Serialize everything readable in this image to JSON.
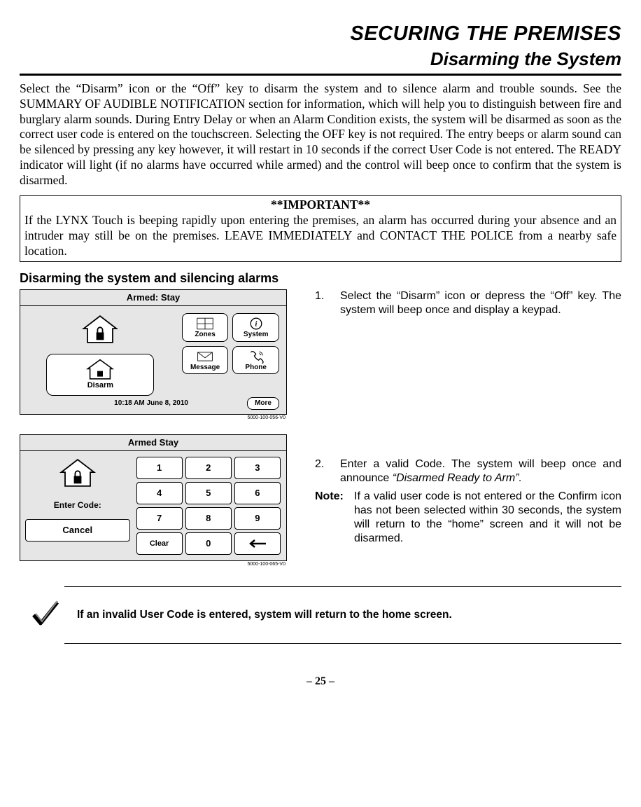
{
  "header": {
    "title": "SECURING THE PREMISES",
    "subtitle": "Disarming the System"
  },
  "intro": "Select the “Disarm” icon or the “Off” key to disarm the system and to silence alarm and trouble sounds. See the SUMMARY OF AUDIBLE NOTIFICATION section for information, which will help you to distinguish between fire and burglary alarm sounds. During Entry Delay or when an Alarm Condition exists, the system will be disarmed as soon as the correct user code is entered on the touchscreen. Selecting the OFF key is not required. The entry beeps or alarm sound can be silenced by pressing any key however, it will restart in 10 seconds if the correct User Code is not entered. The READY indicator will light (if no alarms have occurred while armed) and the control will beep once to confirm that the system is disarmed.",
  "important": {
    "title": "**IMPORTANT**",
    "body": "If the LYNX Touch is beeping rapidly upon entering the premises, an alarm has occurred during your absence and an intruder may still be on the premises. LEAVE IMMEDIATELY and CONTACT THE POLICE from a nearby safe location."
  },
  "section": "Disarming the system and silencing alarms",
  "panel1": {
    "title": "Armed: Stay",
    "disarm": "Disarm",
    "zones": "Zones",
    "system": "System",
    "message": "Message",
    "phone": "Phone",
    "time": "10:18 AM  June 8,  2010",
    "more": "More",
    "tag": "5000-100-056-V0"
  },
  "panel2": {
    "title": "Armed Stay",
    "enter_code": "Enter Code:",
    "cancel": "Cancel",
    "clear": "Clear",
    "keys": [
      "1",
      "2",
      "3",
      "4",
      "5",
      "6",
      "7",
      "8",
      "9"
    ],
    "zero": "0",
    "back": "←",
    "tag": "5000-100-065-V0"
  },
  "steps": {
    "s1_num": "1.",
    "s1": "Select the “Disarm” icon or depress the “Off” key. The system will beep once and display a keypad.",
    "s2_num": "2.",
    "s2a": "Enter a valid Code. The system will beep once and announce ",
    "s2b": "“Disarmed Ready to Arm”.",
    "note_label": "Note:",
    "note": "If a valid user code is not entered or the Confirm icon has not been selected within 30 seconds, the system will return to the “home” screen and it will not be disarmed."
  },
  "check_note": "If an invalid User Code is entered, system will return to the home screen.",
  "page": "– 25 –"
}
